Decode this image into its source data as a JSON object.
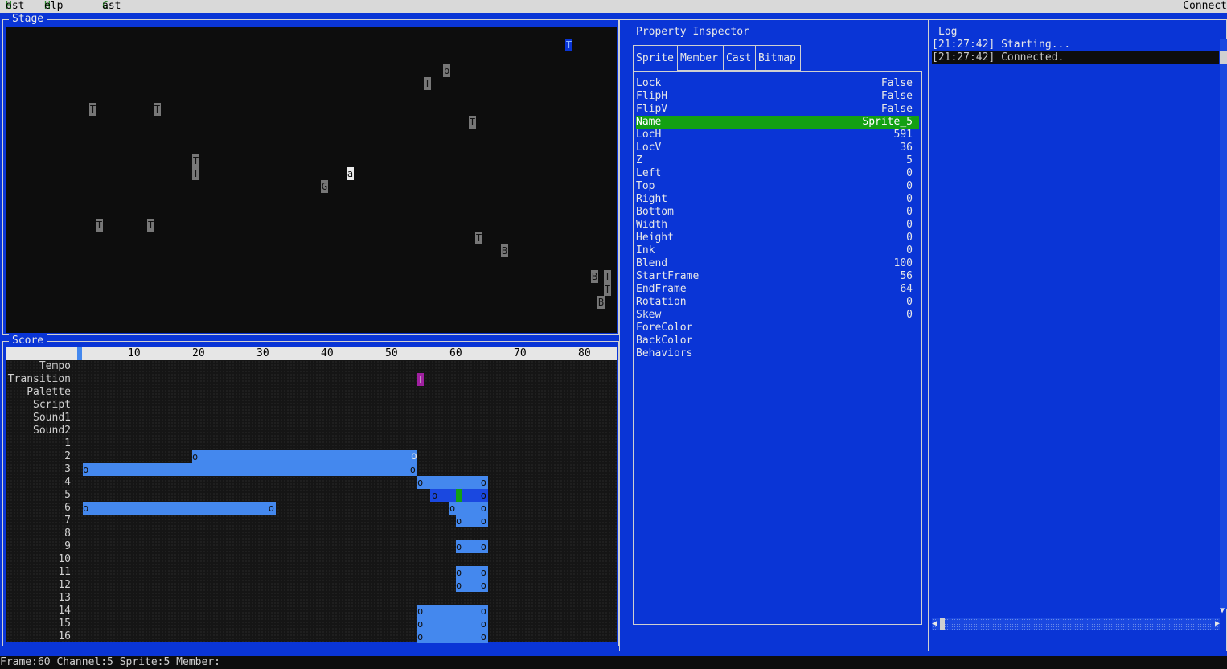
{
  "menubar": {
    "host_h": "H",
    "host_rest": "ost",
    "help_h": "H",
    "help_rest": "elp",
    "cast_c": "C",
    "cast_rest": "ast",
    "connect": "Connect"
  },
  "stage": {
    "title": "Stage",
    "sprites": [
      "T",
      "b",
      "T",
      "T",
      "T",
      "T",
      "T",
      "T",
      "a",
      "G",
      "T",
      "T",
      "T",
      "B",
      "B",
      "T",
      "T",
      "B"
    ]
  },
  "score": {
    "title": "Score",
    "ruler_ticks": [
      "10",
      "20",
      "30",
      "40",
      "50",
      "60",
      "70",
      "80"
    ],
    "channels": [
      "Tempo",
      "Transition",
      "Palette",
      "Script",
      "Sound1",
      "Sound2",
      "1",
      "2",
      "3",
      "4",
      "5",
      "6",
      "7",
      "8",
      "9",
      "10",
      "11",
      "12",
      "13",
      "14",
      "15",
      "16"
    ],
    "transition_marker": "T",
    "bar_marker": "o"
  },
  "inspector": {
    "title": "Property Inspector",
    "tabs": [
      "Sprite",
      "Member",
      "Cast",
      "Bitmap"
    ],
    "properties": [
      {
        "key": "Lock",
        "value": "False"
      },
      {
        "key": "FlipH",
        "value": "False"
      },
      {
        "key": "FlipV",
        "value": "False"
      },
      {
        "key": "Name",
        "value": "Sprite_5"
      },
      {
        "key": "LocH",
        "value": "591"
      },
      {
        "key": "LocV",
        "value": "36"
      },
      {
        "key": "Z",
        "value": "5"
      },
      {
        "key": "Left",
        "value": "0"
      },
      {
        "key": "Top",
        "value": "0"
      },
      {
        "key": "Right",
        "value": "0"
      },
      {
        "key": "Bottom",
        "value": "0"
      },
      {
        "key": "Width",
        "value": "0"
      },
      {
        "key": "Height",
        "value": "0"
      },
      {
        "key": "Ink",
        "value": "0"
      },
      {
        "key": "Blend",
        "value": "100"
      },
      {
        "key": "StartFrame",
        "value": "56"
      },
      {
        "key": "EndFrame",
        "value": "64"
      },
      {
        "key": "Rotation",
        "value": "0"
      },
      {
        "key": "Skew",
        "value": "0"
      },
      {
        "key": "ForeColor",
        "value": ""
      },
      {
        "key": "BackColor",
        "value": ""
      },
      {
        "key": "Behaviors",
        "value": ""
      }
    ]
  },
  "log": {
    "title": "Log",
    "lines": [
      "[21:27:42] Starting...",
      "[21:27:42] Connected."
    ]
  },
  "status": "Frame:60 Channel:5 Sprite:5 Member:"
}
